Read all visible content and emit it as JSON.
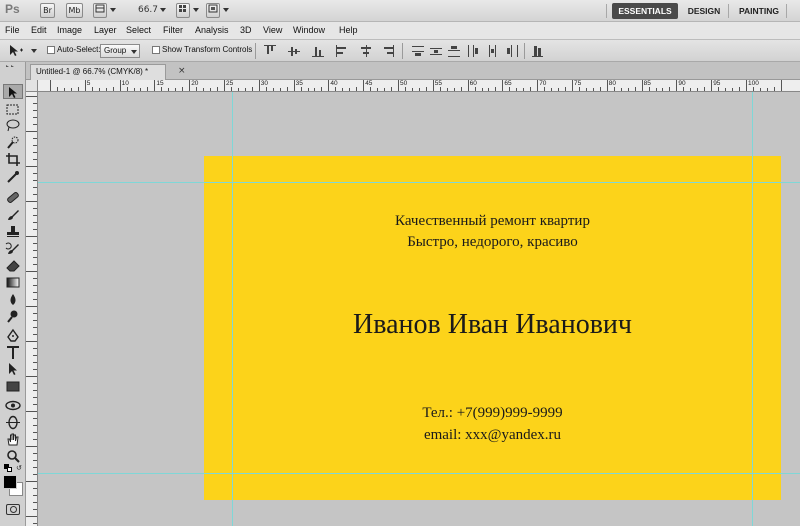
{
  "app": {
    "logo": "Ps",
    "bar_buttons": [
      "Br",
      "Mb"
    ],
    "zoom_value": "66.7"
  },
  "workspaces": [
    "ESSENTIALS",
    "DESIGN",
    "PAINTING"
  ],
  "menu": [
    "File",
    "Edit",
    "Image",
    "Layer",
    "Select",
    "Filter",
    "Analysis",
    "3D",
    "View",
    "Window",
    "Help"
  ],
  "options": {
    "auto_select_label": "Auto-Select:",
    "auto_select_value": "Group",
    "show_transform_label": "Show Transform Controls"
  },
  "document": {
    "tab_title": "Untitled-1 @ 66.7% (CMYK/8) *",
    "close": "×"
  },
  "ruler_numbers": [
    "5",
    "10",
    "15",
    "20",
    "25",
    "30",
    "35",
    "40",
    "45",
    "50",
    "55",
    "60",
    "65",
    "70",
    "75",
    "80",
    "85",
    "90",
    "95",
    "100"
  ],
  "card": {
    "background": "#fcd31a",
    "tagline1": "Качественный ремонт квартир",
    "tagline2": "Быстро, недорого, красиво",
    "name": "Иванов Иван Иванович",
    "phone": "Тел.: +7(999)999-9999",
    "email": "email: xxx@yandex.ru"
  },
  "colors": {
    "guide": "#7fd7d7",
    "workspace_active": "#4a4a4a"
  }
}
